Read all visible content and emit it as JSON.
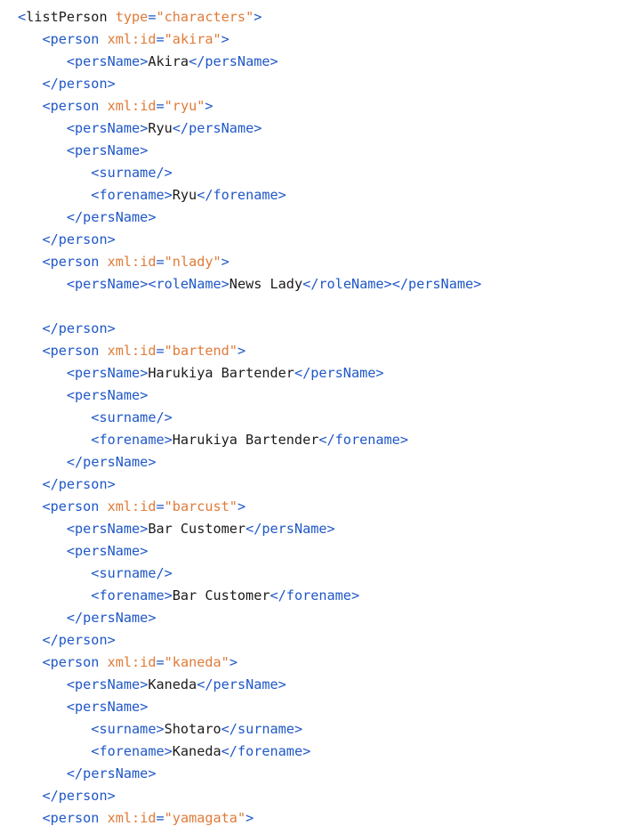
{
  "colors": {
    "tag": "#1f57c8",
    "attribute": "#e07b39",
    "text": "#1b1b1b",
    "background": "#ffffff"
  },
  "lines": [
    {
      "indent": 0,
      "tokens": [
        {
          "t": "punct",
          "v": "<"
        },
        {
          "t": "text",
          "v": "listPerson"
        },
        {
          "t": "text",
          "v": " "
        },
        {
          "t": "attr",
          "v": "type"
        },
        {
          "t": "punct",
          "v": "="
        },
        {
          "t": "value",
          "v": "\"characters\""
        },
        {
          "t": "punct",
          "v": ">"
        }
      ]
    },
    {
      "indent": 1,
      "tokens": [
        {
          "t": "punct",
          "v": "<"
        },
        {
          "t": "tag",
          "v": "person"
        },
        {
          "t": "text",
          "v": " "
        },
        {
          "t": "attr",
          "v": "xml:id"
        },
        {
          "t": "punct",
          "v": "="
        },
        {
          "t": "value",
          "v": "\"akira\""
        },
        {
          "t": "punct",
          "v": ">"
        }
      ]
    },
    {
      "indent": 2,
      "tokens": [
        {
          "t": "punct",
          "v": "<"
        },
        {
          "t": "tag",
          "v": "persName"
        },
        {
          "t": "punct",
          "v": ">"
        },
        {
          "t": "text",
          "v": "Akira"
        },
        {
          "t": "punct",
          "v": "</"
        },
        {
          "t": "tag",
          "v": "persName"
        },
        {
          "t": "punct",
          "v": ">"
        }
      ]
    },
    {
      "indent": 1,
      "tokens": [
        {
          "t": "punct",
          "v": "</"
        },
        {
          "t": "tag",
          "v": "person"
        },
        {
          "t": "punct",
          "v": ">"
        }
      ]
    },
    {
      "indent": 1,
      "tokens": [
        {
          "t": "punct",
          "v": "<"
        },
        {
          "t": "tag",
          "v": "person"
        },
        {
          "t": "text",
          "v": " "
        },
        {
          "t": "attr",
          "v": "xml:id"
        },
        {
          "t": "punct",
          "v": "="
        },
        {
          "t": "value",
          "v": "\"ryu\""
        },
        {
          "t": "punct",
          "v": ">"
        }
      ]
    },
    {
      "indent": 2,
      "tokens": [
        {
          "t": "punct",
          "v": "<"
        },
        {
          "t": "tag",
          "v": "persName"
        },
        {
          "t": "punct",
          "v": ">"
        },
        {
          "t": "text",
          "v": "Ryu"
        },
        {
          "t": "punct",
          "v": "</"
        },
        {
          "t": "tag",
          "v": "persName"
        },
        {
          "t": "punct",
          "v": ">"
        }
      ]
    },
    {
      "indent": 2,
      "tokens": [
        {
          "t": "punct",
          "v": "<"
        },
        {
          "t": "tag",
          "v": "persName"
        },
        {
          "t": "punct",
          "v": ">"
        }
      ]
    },
    {
      "indent": 3,
      "tokens": [
        {
          "t": "punct",
          "v": "<"
        },
        {
          "t": "tag",
          "v": "surname"
        },
        {
          "t": "punct",
          "v": "/>"
        }
      ]
    },
    {
      "indent": 3,
      "tokens": [
        {
          "t": "punct",
          "v": "<"
        },
        {
          "t": "tag",
          "v": "forename"
        },
        {
          "t": "punct",
          "v": ">"
        },
        {
          "t": "text",
          "v": "Ryu"
        },
        {
          "t": "punct",
          "v": "</"
        },
        {
          "t": "tag",
          "v": "forename"
        },
        {
          "t": "punct",
          "v": ">"
        }
      ]
    },
    {
      "indent": 2,
      "tokens": [
        {
          "t": "punct",
          "v": "</"
        },
        {
          "t": "tag",
          "v": "persName"
        },
        {
          "t": "punct",
          "v": ">"
        }
      ]
    },
    {
      "indent": 1,
      "tokens": [
        {
          "t": "punct",
          "v": "</"
        },
        {
          "t": "tag",
          "v": "person"
        },
        {
          "t": "punct",
          "v": ">"
        }
      ]
    },
    {
      "indent": 1,
      "tokens": [
        {
          "t": "punct",
          "v": "<"
        },
        {
          "t": "tag",
          "v": "person"
        },
        {
          "t": "text",
          "v": " "
        },
        {
          "t": "attr",
          "v": "xml:id"
        },
        {
          "t": "punct",
          "v": "="
        },
        {
          "t": "value",
          "v": "\"nlady\""
        },
        {
          "t": "punct",
          "v": ">"
        }
      ]
    },
    {
      "indent": 2,
      "tokens": [
        {
          "t": "punct",
          "v": "<"
        },
        {
          "t": "tag",
          "v": "persName"
        },
        {
          "t": "punct",
          "v": "><"
        },
        {
          "t": "tag",
          "v": "roleName"
        },
        {
          "t": "punct",
          "v": ">"
        },
        {
          "t": "text",
          "v": "News Lady"
        },
        {
          "t": "punct",
          "v": "</"
        },
        {
          "t": "tag",
          "v": "roleName"
        },
        {
          "t": "punct",
          "v": "></"
        },
        {
          "t": "tag",
          "v": "persName"
        },
        {
          "t": "punct",
          "v": ">"
        }
      ]
    },
    {
      "indent": 0,
      "tokens": []
    },
    {
      "indent": 1,
      "tokens": [
        {
          "t": "punct",
          "v": "</"
        },
        {
          "t": "tag",
          "v": "person"
        },
        {
          "t": "punct",
          "v": ">"
        }
      ]
    },
    {
      "indent": 1,
      "tokens": [
        {
          "t": "punct",
          "v": "<"
        },
        {
          "t": "tag",
          "v": "person"
        },
        {
          "t": "text",
          "v": " "
        },
        {
          "t": "attr",
          "v": "xml:id"
        },
        {
          "t": "punct",
          "v": "="
        },
        {
          "t": "value",
          "v": "\"bartend\""
        },
        {
          "t": "punct",
          "v": ">"
        }
      ]
    },
    {
      "indent": 2,
      "tokens": [
        {
          "t": "punct",
          "v": "<"
        },
        {
          "t": "tag",
          "v": "persName"
        },
        {
          "t": "punct",
          "v": ">"
        },
        {
          "t": "text",
          "v": "Harukiya Bartender"
        },
        {
          "t": "punct",
          "v": "</"
        },
        {
          "t": "tag",
          "v": "persName"
        },
        {
          "t": "punct",
          "v": ">"
        }
      ]
    },
    {
      "indent": 2,
      "tokens": [
        {
          "t": "punct",
          "v": "<"
        },
        {
          "t": "tag",
          "v": "persName"
        },
        {
          "t": "punct",
          "v": ">"
        }
      ]
    },
    {
      "indent": 3,
      "tokens": [
        {
          "t": "punct",
          "v": "<"
        },
        {
          "t": "tag",
          "v": "surname"
        },
        {
          "t": "punct",
          "v": "/>"
        }
      ]
    },
    {
      "indent": 3,
      "tokens": [
        {
          "t": "punct",
          "v": "<"
        },
        {
          "t": "tag",
          "v": "forename"
        },
        {
          "t": "punct",
          "v": ">"
        },
        {
          "t": "text",
          "v": "Harukiya Bartender"
        },
        {
          "t": "punct",
          "v": "</"
        },
        {
          "t": "tag",
          "v": "forename"
        },
        {
          "t": "punct",
          "v": ">"
        }
      ]
    },
    {
      "indent": 2,
      "tokens": [
        {
          "t": "punct",
          "v": "</"
        },
        {
          "t": "tag",
          "v": "persName"
        },
        {
          "t": "punct",
          "v": ">"
        }
      ]
    },
    {
      "indent": 1,
      "tokens": [
        {
          "t": "punct",
          "v": "</"
        },
        {
          "t": "tag",
          "v": "person"
        },
        {
          "t": "punct",
          "v": ">"
        }
      ]
    },
    {
      "indent": 1,
      "tokens": [
        {
          "t": "punct",
          "v": "<"
        },
        {
          "t": "tag",
          "v": "person"
        },
        {
          "t": "text",
          "v": " "
        },
        {
          "t": "attr",
          "v": "xml:id"
        },
        {
          "t": "punct",
          "v": "="
        },
        {
          "t": "value",
          "v": "\"barcust\""
        },
        {
          "t": "punct",
          "v": ">"
        }
      ]
    },
    {
      "indent": 2,
      "tokens": [
        {
          "t": "punct",
          "v": "<"
        },
        {
          "t": "tag",
          "v": "persName"
        },
        {
          "t": "punct",
          "v": ">"
        },
        {
          "t": "text",
          "v": "Bar Customer"
        },
        {
          "t": "punct",
          "v": "</"
        },
        {
          "t": "tag",
          "v": "persName"
        },
        {
          "t": "punct",
          "v": ">"
        }
      ]
    },
    {
      "indent": 2,
      "tokens": [
        {
          "t": "punct",
          "v": "<"
        },
        {
          "t": "tag",
          "v": "persName"
        },
        {
          "t": "punct",
          "v": ">"
        }
      ]
    },
    {
      "indent": 3,
      "tokens": [
        {
          "t": "punct",
          "v": "<"
        },
        {
          "t": "tag",
          "v": "surname"
        },
        {
          "t": "punct",
          "v": "/>"
        }
      ]
    },
    {
      "indent": 3,
      "tokens": [
        {
          "t": "punct",
          "v": "<"
        },
        {
          "t": "tag",
          "v": "forename"
        },
        {
          "t": "punct",
          "v": ">"
        },
        {
          "t": "text",
          "v": "Bar Customer"
        },
        {
          "t": "punct",
          "v": "</"
        },
        {
          "t": "tag",
          "v": "forename"
        },
        {
          "t": "punct",
          "v": ">"
        }
      ]
    },
    {
      "indent": 2,
      "tokens": [
        {
          "t": "punct",
          "v": "</"
        },
        {
          "t": "tag",
          "v": "persName"
        },
        {
          "t": "punct",
          "v": ">"
        }
      ]
    },
    {
      "indent": 1,
      "tokens": [
        {
          "t": "punct",
          "v": "</"
        },
        {
          "t": "tag",
          "v": "person"
        },
        {
          "t": "punct",
          "v": ">"
        }
      ]
    },
    {
      "indent": 1,
      "tokens": [
        {
          "t": "punct",
          "v": "<"
        },
        {
          "t": "tag",
          "v": "person"
        },
        {
          "t": "text",
          "v": " "
        },
        {
          "t": "attr",
          "v": "xml:id"
        },
        {
          "t": "punct",
          "v": "="
        },
        {
          "t": "value",
          "v": "\"kaneda\""
        },
        {
          "t": "punct",
          "v": ">"
        }
      ]
    },
    {
      "indent": 2,
      "tokens": [
        {
          "t": "punct",
          "v": "<"
        },
        {
          "t": "tag",
          "v": "persName"
        },
        {
          "t": "punct",
          "v": ">"
        },
        {
          "t": "text",
          "v": "Kaneda"
        },
        {
          "t": "punct",
          "v": "</"
        },
        {
          "t": "tag",
          "v": "persName"
        },
        {
          "t": "punct",
          "v": ">"
        }
      ]
    },
    {
      "indent": 2,
      "tokens": [
        {
          "t": "punct",
          "v": "<"
        },
        {
          "t": "tag",
          "v": "persName"
        },
        {
          "t": "punct",
          "v": ">"
        }
      ]
    },
    {
      "indent": 3,
      "tokens": [
        {
          "t": "punct",
          "v": "<"
        },
        {
          "t": "tag",
          "v": "surname"
        },
        {
          "t": "punct",
          "v": ">"
        },
        {
          "t": "text",
          "v": "Shotaro"
        },
        {
          "t": "punct",
          "v": "</"
        },
        {
          "t": "tag",
          "v": "surname"
        },
        {
          "t": "punct",
          "v": ">"
        }
      ]
    },
    {
      "indent": 3,
      "tokens": [
        {
          "t": "punct",
          "v": "<"
        },
        {
          "t": "tag",
          "v": "forename"
        },
        {
          "t": "punct",
          "v": ">"
        },
        {
          "t": "text",
          "v": "Kaneda"
        },
        {
          "t": "punct",
          "v": "</"
        },
        {
          "t": "tag",
          "v": "forename"
        },
        {
          "t": "punct",
          "v": ">"
        }
      ]
    },
    {
      "indent": 2,
      "tokens": [
        {
          "t": "punct",
          "v": "</"
        },
        {
          "t": "tag",
          "v": "persName"
        },
        {
          "t": "punct",
          "v": ">"
        }
      ]
    },
    {
      "indent": 1,
      "tokens": [
        {
          "t": "punct",
          "v": "</"
        },
        {
          "t": "tag",
          "v": "person"
        },
        {
          "t": "punct",
          "v": ">"
        }
      ]
    },
    {
      "indent": 1,
      "tokens": [
        {
          "t": "punct",
          "v": "<"
        },
        {
          "t": "tag",
          "v": "person"
        },
        {
          "t": "text",
          "v": " "
        },
        {
          "t": "attr",
          "v": "xml:id"
        },
        {
          "t": "punct",
          "v": "="
        },
        {
          "t": "value",
          "v": "\"yamagata\""
        },
        {
          "t": "punct",
          "v": ">"
        }
      ]
    }
  ]
}
